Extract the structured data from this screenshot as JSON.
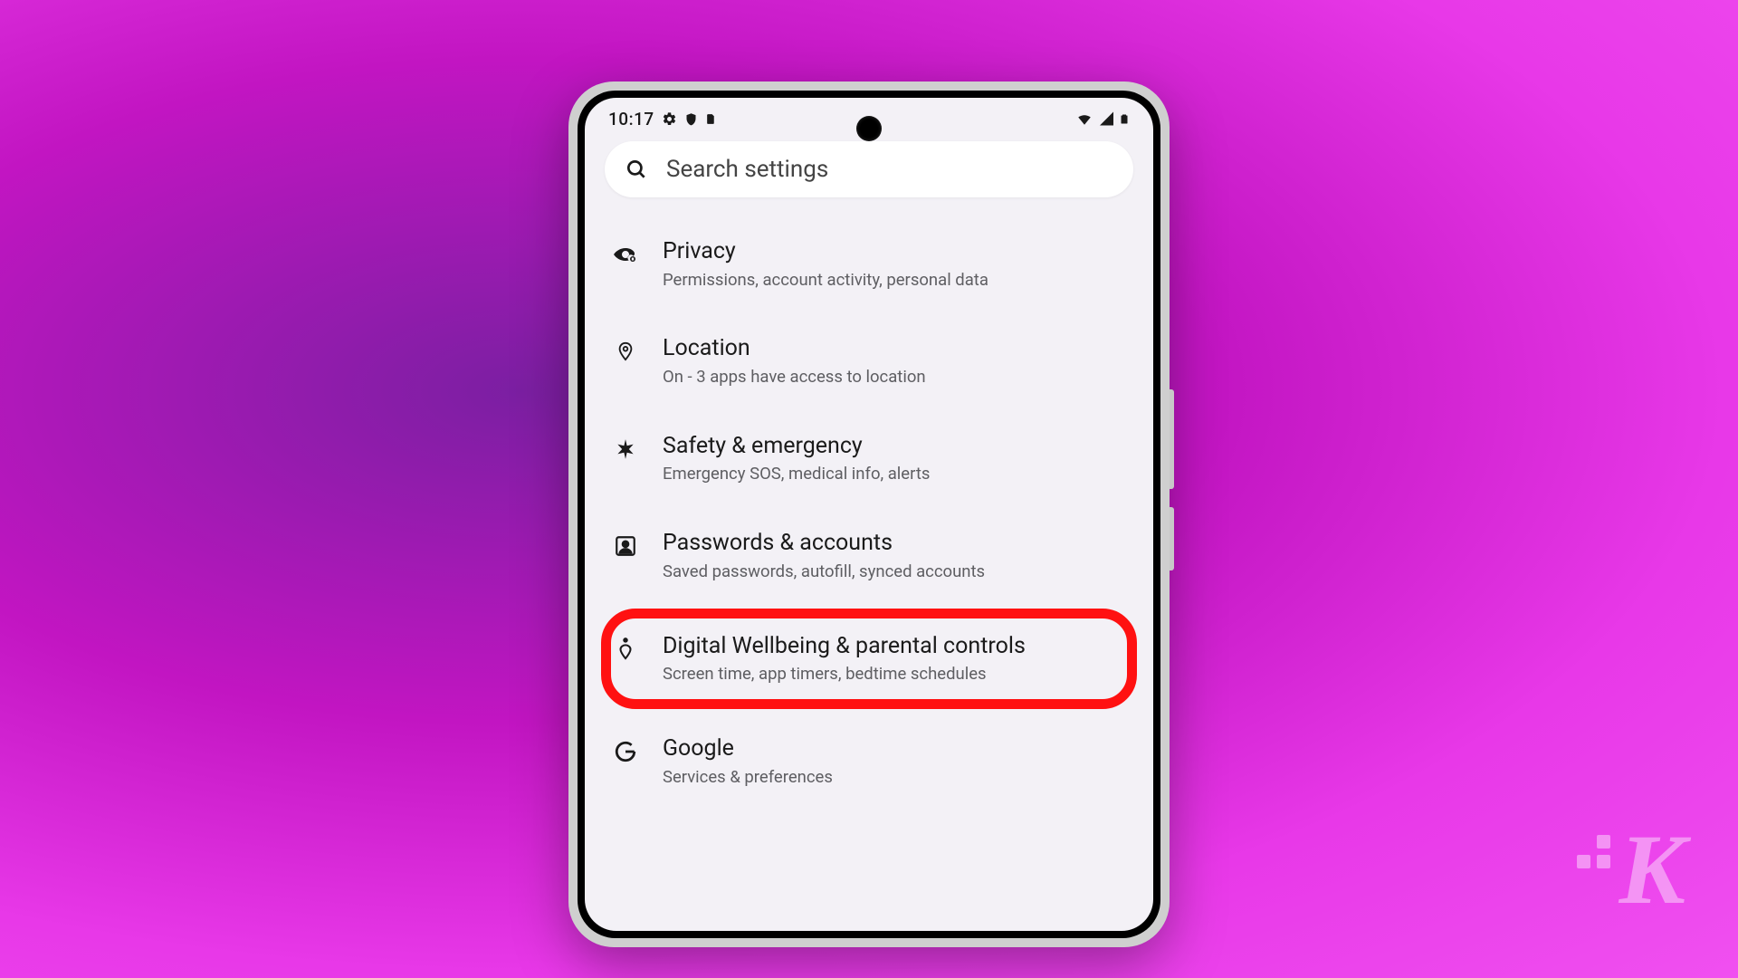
{
  "status_bar": {
    "time": "10:17",
    "icons_left": [
      "gear-icon",
      "shield-icon",
      "sim-icon"
    ],
    "icons_right": [
      "wifi-icon",
      "signal-icon",
      "battery-icon"
    ]
  },
  "search": {
    "placeholder": "Search settings"
  },
  "settings": [
    {
      "key": "privacy",
      "icon": "privacy-eye-icon",
      "title": "Privacy",
      "subtitle": "Permissions, account activity, personal data",
      "highlighted": false
    },
    {
      "key": "location",
      "icon": "location-pin-icon",
      "title": "Location",
      "subtitle": "On - 3 apps have access to location",
      "highlighted": false
    },
    {
      "key": "safety",
      "icon": "asterisk-icon",
      "title": "Safety & emergency",
      "subtitle": "Emergency SOS, medical info, alerts",
      "highlighted": false
    },
    {
      "key": "passwords",
      "icon": "account-box-icon",
      "title": "Passwords & accounts",
      "subtitle": "Saved passwords, autofill, synced accounts",
      "highlighted": false
    },
    {
      "key": "digital-wellbeing",
      "icon": "wellbeing-icon",
      "title": "Digital Wellbeing & parental controls",
      "subtitle": "Screen time, app timers, bedtime schedules",
      "highlighted": true
    },
    {
      "key": "google",
      "icon": "google-g-icon",
      "title": "Google",
      "subtitle": "Services & preferences",
      "highlighted": false
    }
  ],
  "watermark": {
    "letter": "K"
  },
  "highlight_color": "#ff1111"
}
